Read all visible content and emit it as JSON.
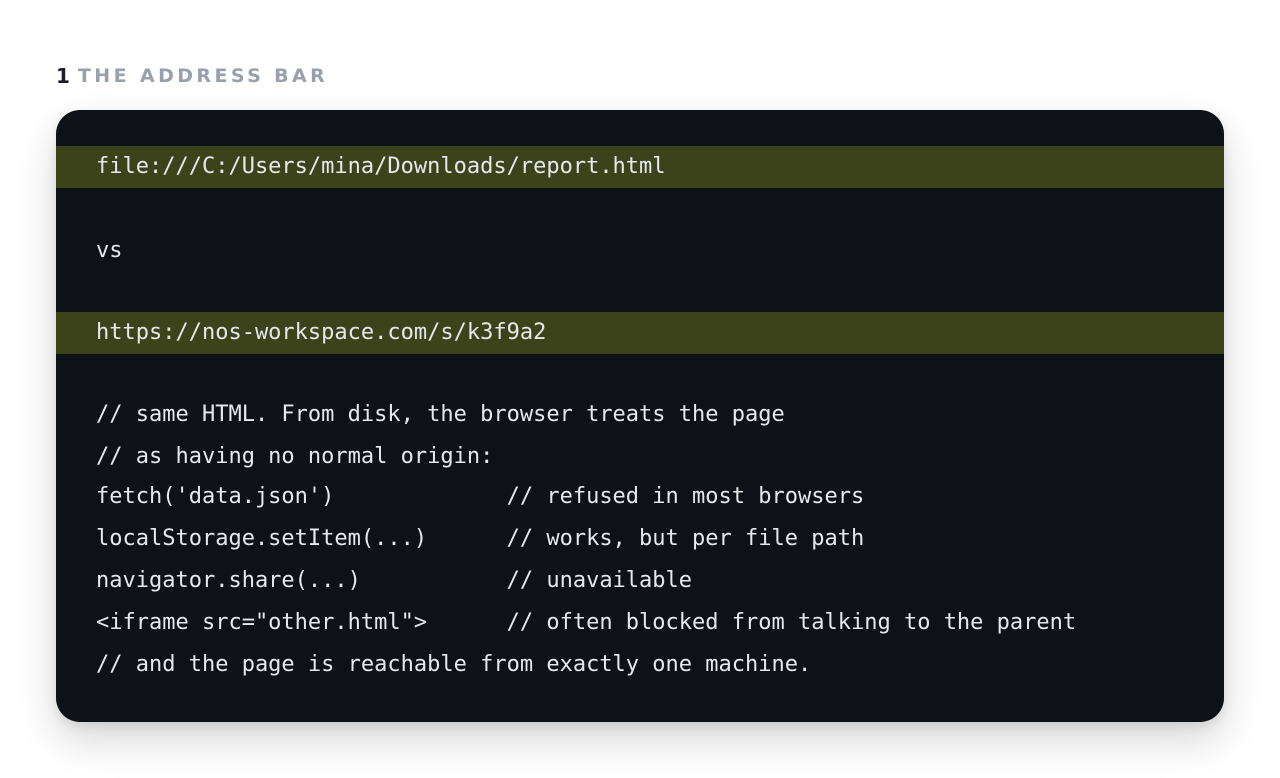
{
  "section": {
    "number": "1",
    "title": "THE ADDRESS BAR"
  },
  "code": {
    "lines": [
      {
        "text": "file:///C:/Users/mina/Downloads/report.html",
        "highlight": true
      },
      {
        "text": "",
        "highlight": false
      },
      {
        "text": "vs",
        "highlight": false
      },
      {
        "text": "",
        "highlight": false
      },
      {
        "text": "https://nos-workspace.com/s/k3f9a2",
        "highlight": true
      },
      {
        "text": "",
        "highlight": false
      },
      {
        "text": "// same HTML. From disk, the browser treats the page",
        "highlight": false
      },
      {
        "text": "// as having no normal origin:",
        "highlight": false
      },
      {
        "text": "fetch('data.json')             // refused in most browsers",
        "highlight": false
      },
      {
        "text": "localStorage.setItem(...)      // works, but per file path",
        "highlight": false
      },
      {
        "text": "navigator.share(...)           // unavailable",
        "highlight": false
      },
      {
        "text": "<iframe src=\"other.html\">      // often blocked from talking to the parent",
        "highlight": false
      },
      {
        "text": "// and the page is reachable from exactly one machine.",
        "highlight": false
      }
    ]
  },
  "colors": {
    "card_background": "#0e1117",
    "highlight_background": "#3c431b",
    "code_text": "#e6e8ec",
    "heading_number": "#1b1f27",
    "heading_title": "#9aa0ab"
  }
}
